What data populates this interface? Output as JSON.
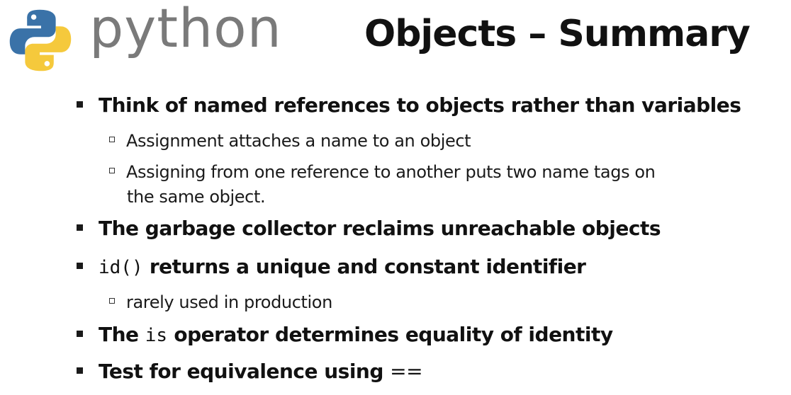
{
  "header": {
    "logo_text": "python",
    "title": "Objects – Summary"
  },
  "bullets": {
    "b1": {
      "text": "Think of named references to objects rather than variables",
      "sub1": "Assignment attaches a name  to an object",
      "sub2_line1": "Assigning from one reference to another puts two name tags on",
      "sub2_line2": "the same object."
    },
    "b2": {
      "text": "The garbage collector reclaims unreachable objects"
    },
    "b3": {
      "code": "id()",
      "text": " returns a unique and constant identifier",
      "sub1": "rarely used in production"
    },
    "b4": {
      "prefix": "The ",
      "code": "is",
      "text": " operator determines equality of identity"
    },
    "b5": {
      "text": "Test for equivalence using ",
      "code": "=="
    }
  },
  "colors": {
    "python_blue": "#3a72a8",
    "python_yellow": "#f5c93c",
    "logo_text": "#7a7a7a",
    "text": "#111111"
  },
  "icons": {
    "logo": "python-logo-icon",
    "bullet": "filled-square-bullet",
    "sub_bullet": "hollow-square-bullet"
  }
}
